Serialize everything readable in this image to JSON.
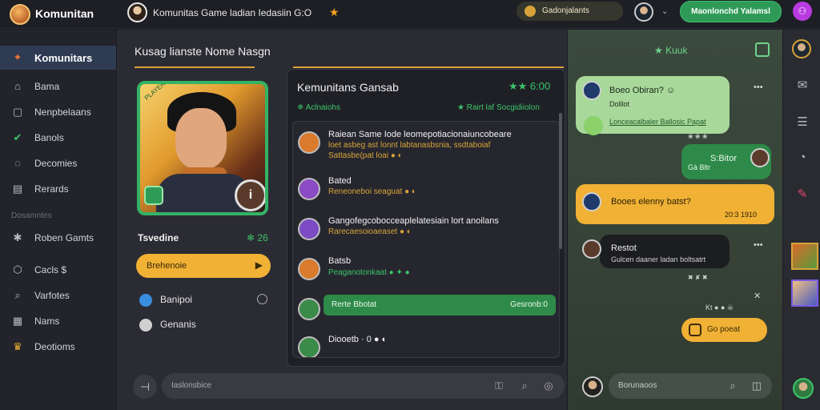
{
  "app": {
    "brand": "Komunitan",
    "chat_title": "Komunitas Game ladian Iedasiin G:O",
    "status": "Gadonjalants",
    "cta": "Maonlonchd Yalamsl"
  },
  "sidebar": {
    "items": [
      {
        "label": "Komunitars",
        "icon": "home-icon"
      },
      {
        "label": "Bama",
        "icon": "house-icon"
      },
      {
        "label": "Nenpbelaans",
        "icon": "square-icon"
      },
      {
        "label": "Banols",
        "icon": "check-icon"
      },
      {
        "label": "Decomies",
        "icon": "chat-icon"
      },
      {
        "label": "Rerards",
        "icon": "box-icon"
      }
    ],
    "section": "Dosamntes",
    "items2": [
      {
        "label": "Roben Gamts",
        "icon": "star-icon"
      },
      {
        "label": "Cacls $",
        "icon": "tag-icon"
      },
      {
        "label": "Varfotes",
        "icon": "search-icon"
      },
      {
        "label": "Nams",
        "icon": "grid-icon"
      },
      {
        "label": "Deotioms",
        "icon": "crown-icon"
      }
    ]
  },
  "profile": {
    "title": "Kusag lianste Nome Nasgn",
    "card_tag": "PLAYER",
    "stat_label": "Tsvedine",
    "stat_value": "❄ 26",
    "play_label": "Brehenoie",
    "options": [
      {
        "label": "Banipoi"
      },
      {
        "label": "Genanis"
      }
    ],
    "compose_icon": "⊣"
  },
  "group": {
    "title": "Kemunitans Gansab",
    "stars": "★★ 6:00",
    "sub_left": "✵ Aclnaiohs",
    "sub_right": "★ Rairt laf Socgidiiolon",
    "messages": [
      {
        "name": "Raiean Same Iode leomepotiacionaiuncobeare",
        "l1": "loet asbeg ast lonnt labtanasbsnia, ssdtaboiaf",
        "l2": "Sattasbe(pat loai ● ◐",
        "avatar": "#d97a2c"
      },
      {
        "name": "Bated",
        "l1": "Reneoneboi seaguat ● ◐",
        "avatar": "#8a4bc4"
      },
      {
        "name": "Gangofegcobocceaplelatesiain lort anoilans",
        "l1": "Rarecaesoioaeaset ● ◐",
        "avatar": "#7c4bc4"
      },
      {
        "name": "Batsb",
        "l1": "Peaganotonkaat ● ✦ ●",
        "avatar": "#d97a2c"
      },
      {
        "name": "Diooetb · 0 ● ◐",
        "avatar": "#3a8a4a"
      }
    ],
    "highlight": {
      "left": "Rerte Bbotat",
      "right": "Gesronb:0"
    },
    "compose_placeholder": "Iaslonsbice"
  },
  "chat": {
    "header": "★ Kuuk",
    "bubbles": [
      {
        "t1": "Boeo Obiran? ☺",
        "t2": "Dolllot",
        "t3": "Lonceacalbaler Ballosic Papat"
      },
      {
        "t1": "Gà Bltr",
        "meta": "✖ ✘ ✖ ✔"
      },
      {
        "t1": "S:Bitor"
      },
      {
        "t1": "Booes elenny batst?",
        "meta": "20:3 1910"
      },
      {
        "t1": "Restot",
        "t2": "Gulcen daaner ladan boltsatrt"
      },
      {
        "t1": "Go poeat"
      }
    ],
    "tiny1": "❀ ❀ ❀",
    "tiny2": "✖ ✘ ✖",
    "tiny3": "Kt ● ● ☠",
    "compose_placeholder": "Borunaoos"
  },
  "colors": {
    "accent_green": "#2f9a58",
    "accent_gold": "#f0b135"
  }
}
